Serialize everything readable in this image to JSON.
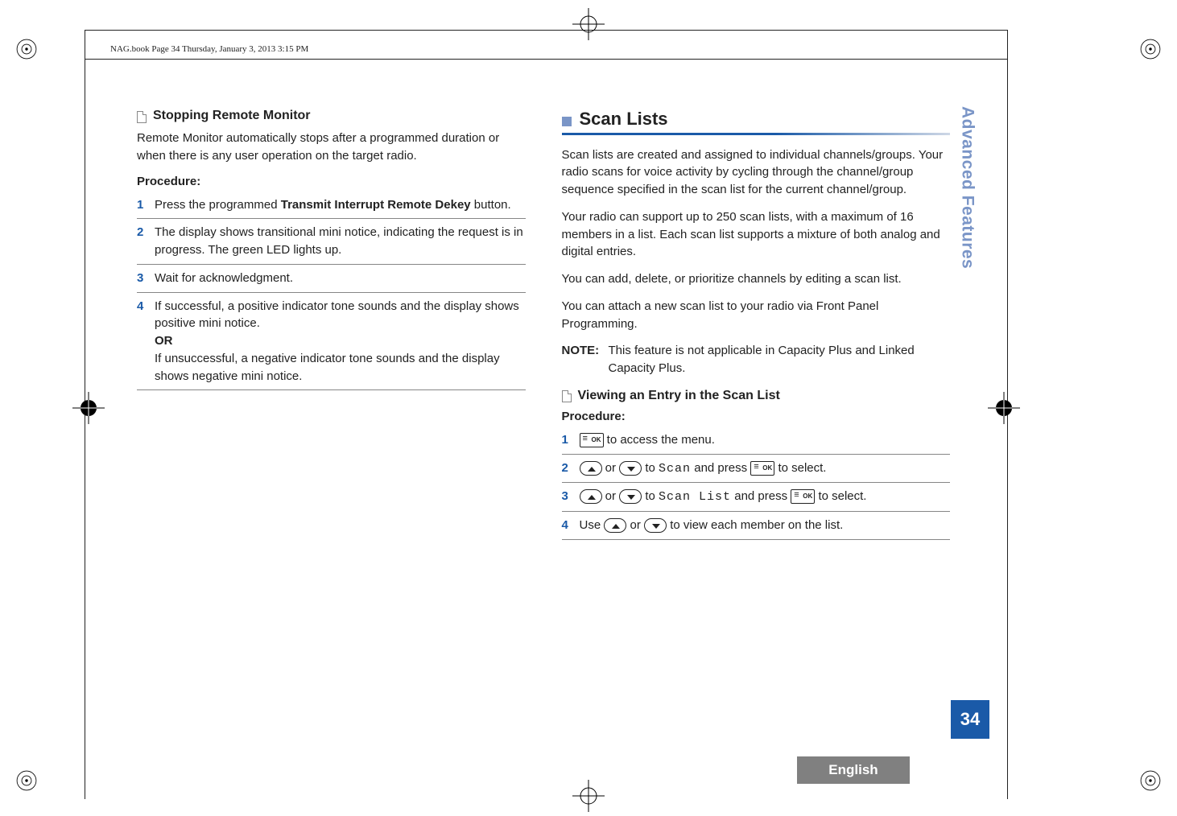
{
  "header": {
    "stamp": "NAG.book  Page 34  Thursday, January 3, 2013  3:15 PM"
  },
  "left": {
    "subheading": "Stopping Remote Monitor",
    "intro": "Remote Monitor automatically stops after a programmed duration or when there is any user operation on the target radio.",
    "procedureLabel": "Procedure:",
    "steps": {
      "s1": {
        "num": "1",
        "pre": "Press the programmed ",
        "bold": "Transmit Interrupt Remote Dekey",
        "post": " button."
      },
      "s2": {
        "num": "2",
        "text": "The display shows transitional mini notice, indicating the request is in progress. The green LED lights up."
      },
      "s3": {
        "num": "3",
        "text": "Wait for acknowledgment."
      },
      "s4": {
        "num": "4",
        "line1": "If successful, a positive indicator tone sounds and the display shows positive mini notice.",
        "or": "OR",
        "line2": "If unsuccessful, a negative indicator tone sounds and the display shows negative mini notice."
      }
    }
  },
  "right": {
    "sectionTitle": "Scan Lists",
    "p1": "Scan lists are created and assigned to individual channels/groups. Your radio scans for voice activity by cycling through the channel/group sequence specified in the scan list for the current channel/group.",
    "p2": "Your radio can support up to 250 scan lists, with a maximum of 16 members in a list. Each scan list supports a mixture of both analog and digital entries.",
    "p3": "You can add, delete, or prioritize channels by editing a scan list.",
    "p4": "You can attach a new scan list to your radio via Front Panel Programming.",
    "noteLabel": "NOTE:",
    "noteText": "This feature is not applicable in Capacity Plus and Linked Capacity Plus.",
    "subheading2": "Viewing an Entry in the Scan List",
    "procedureLabel": "Procedure:",
    "steps": {
      "s1": {
        "num": "1",
        "tail": " to access the menu."
      },
      "s2": {
        "num": "2",
        "mid1": " or ",
        "mid2": " to ",
        "mono": "Scan",
        "mid3": " and press ",
        "tail": " to select."
      },
      "s3": {
        "num": "3",
        "mid1": " or ",
        "mid2": " to ",
        "mono": "Scan List",
        "mid3": " and press ",
        "tail": " to select."
      },
      "s4": {
        "num": "4",
        "pre": "Use ",
        "mid1": " or ",
        "tail": " to view each member on the list."
      }
    }
  },
  "chrome": {
    "sideTab": "Advanced Features",
    "pageNumber": "34",
    "language": "English",
    "okLabel": "OK"
  }
}
